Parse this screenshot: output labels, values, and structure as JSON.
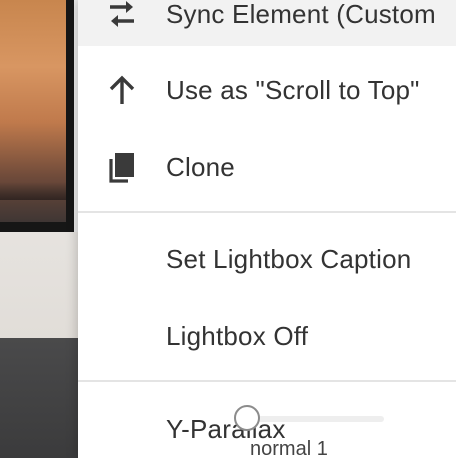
{
  "menu": {
    "items": [
      {
        "label": "Sync Element (Custom",
        "icon": "sync-arrows-icon"
      },
      {
        "label": "Use as \"Scroll to Top\"",
        "icon": "arrow-up-icon"
      },
      {
        "label": "Clone",
        "icon": "clone-icon"
      },
      {
        "label": "Set Lightbox Caption",
        "icon": ""
      },
      {
        "label": "Lightbox Off",
        "icon": ""
      }
    ],
    "parallax": {
      "label": "Y-Parallax",
      "value_text": "normal 1",
      "level": 0
    }
  },
  "colors": {
    "menu_bg": "#ffffff",
    "hover_bg": "#f2f2f2",
    "text": "#333333",
    "icon": "#3a3a3a",
    "divider": "#e4e4e4"
  }
}
